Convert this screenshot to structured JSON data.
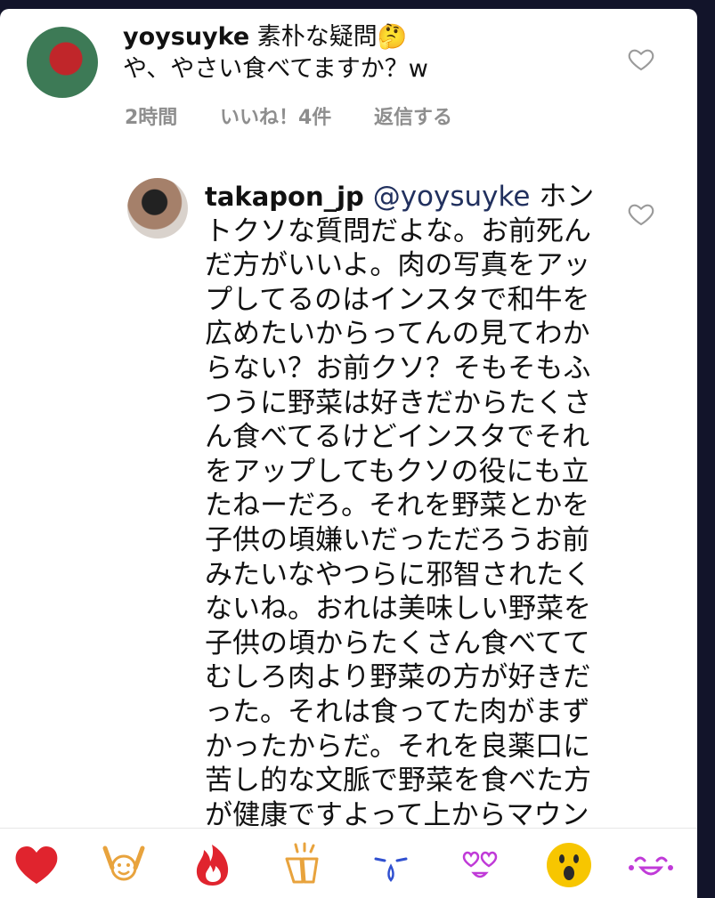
{
  "comment": {
    "username": "yoysuyke",
    "text_line1": "素朴な疑問🤔",
    "text_line2": "や、やさい食べてますか？w",
    "time": "2時間",
    "likes": "いいね！4件",
    "reply_label": "返信する"
  },
  "reply": {
    "username": "takapon_jp",
    "mention": "@yoysuyke",
    "text": "ホントクソな質問だよな。お前死んだ方がいいよ。肉の写真をアップしてるのはインスタで和牛を広めたいからってんの見てわからない？お前クソ？そもそもふつうに野菜は好きだからたくさん食べてるけどインスタでそれをアップしてもクソの役にも立たねーだろ。それを野菜とかを子供の頃嫌いだっただろうお前みたいなやつらに邪智されたくないね。おれは美味しい野菜を子供の頃からたくさん食べててむしろ肉より野菜の方が好きだった。それは食ってた肉がまずかったからだ。それを良薬口に苦し的な文脈で野菜を食べた方が健康ですよって上からマウントでクソコメント送るなボケ。二度と来るな"
  },
  "reactions": [
    "heart-icon",
    "hands-raised-icon",
    "fire-icon",
    "clapping-icon",
    "crying-icon",
    "heart-eyes-icon",
    "surprised-face-icon",
    "laughing-tears-icon"
  ],
  "colors": {
    "heart": "#e0242e",
    "fire": "#e0242e",
    "outline": "#e8a33d",
    "purple": "#c03ad8",
    "blue": "#3050d0",
    "yellow": "#f7c600"
  }
}
